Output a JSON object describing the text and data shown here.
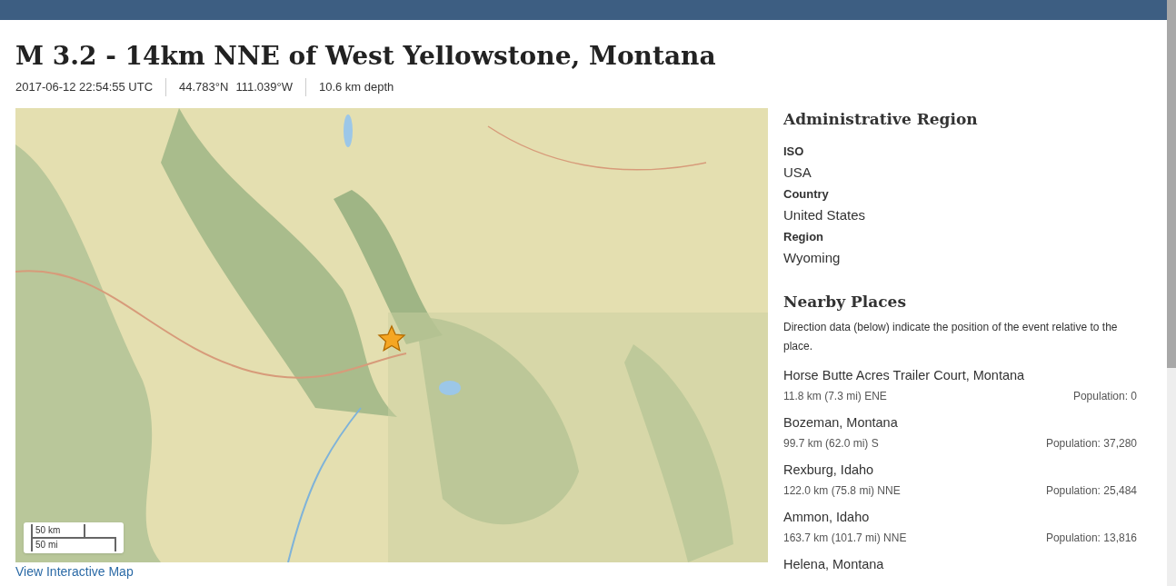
{
  "title": "M 3.2 - 14km NNE of West Yellowstone, Montana",
  "meta": {
    "time": "2017-06-12 22:54:55 UTC",
    "latitude": "44.783°N",
    "longitude": "111.039°W",
    "depth": "10.6 km depth"
  },
  "map": {
    "kind": "picture",
    "scale": [
      "50 km",
      "50 mi"
    ],
    "link": "View Interactive Map"
  },
  "administrative_region": {
    "heading": "Administrative Region",
    "fields": [
      {
        "label": "ISO",
        "value": "USA"
      },
      {
        "label": "Country",
        "value": "United States"
      },
      {
        "label": "Region",
        "value": "Wyoming"
      }
    ]
  },
  "nearby_places": {
    "heading": "Nearby Places",
    "note": "Direction data (below) indicate the position of the event relative to the place.",
    "places": [
      {
        "name": "Horse Butte Acres Trailer Court, Montana",
        "distance": "11.8 km (7.3 mi) ENE",
        "population": "Population: 0"
      },
      {
        "name": "Bozeman, Montana",
        "distance": "99.7 km (62.0 mi) S",
        "population": "Population: 37,280"
      },
      {
        "name": "Rexburg, Idaho",
        "distance": "122.0 km (75.8 mi) NNE",
        "population": "Population: 25,484"
      },
      {
        "name": "Ammon, Idaho",
        "distance": "163.7 km (101.7 mi) NNE",
        "population": "Population: 13,816"
      },
      {
        "name": "Helena, Montana"
      }
    ]
  }
}
